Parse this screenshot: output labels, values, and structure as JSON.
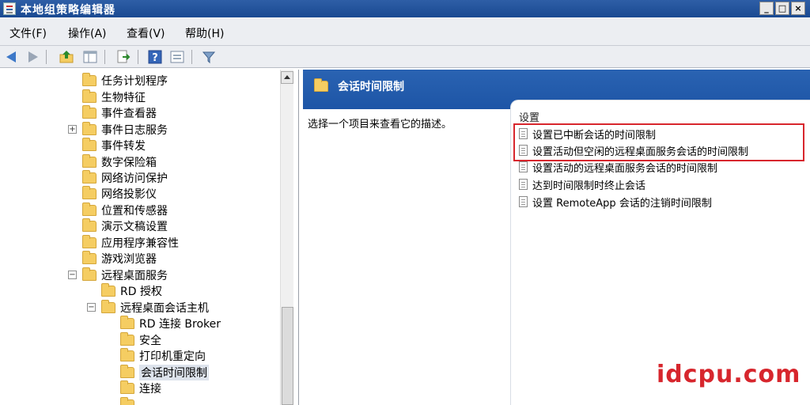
{
  "window": {
    "title": "本地组策略编辑器"
  },
  "window_controls": {
    "minimize": "_",
    "maximize": "□",
    "close": "×"
  },
  "menu": [
    "文件(F)",
    "操作(A)",
    "查看(V)",
    "帮助(H)"
  ],
  "toolbar": {
    "buttons": [
      "back-icon",
      "forward-icon",
      "up-folder-icon",
      "show-hide-tree-icon",
      "export-icon",
      "help-icon",
      "properties-icon",
      "filter-icon"
    ]
  },
  "tree": {
    "items": [
      {
        "label": "任务计划程序",
        "level": 0,
        "expander": ""
      },
      {
        "label": "生物特征",
        "level": 0,
        "expander": ""
      },
      {
        "label": "事件查看器",
        "level": 0,
        "expander": ""
      },
      {
        "label": "事件日志服务",
        "level": 0,
        "expander": "+"
      },
      {
        "label": "事件转发",
        "level": 0,
        "expander": ""
      },
      {
        "label": "数字保险箱",
        "level": 0,
        "expander": ""
      },
      {
        "label": "网络访问保护",
        "level": 0,
        "expander": ""
      },
      {
        "label": "网络投影仪",
        "level": 0,
        "expander": ""
      },
      {
        "label": "位置和传感器",
        "level": 0,
        "expander": ""
      },
      {
        "label": "演示文稿设置",
        "level": 0,
        "expander": ""
      },
      {
        "label": "应用程序兼容性",
        "level": 0,
        "expander": ""
      },
      {
        "label": "游戏浏览器",
        "level": 0,
        "expander": ""
      },
      {
        "label": "远程桌面服务",
        "level": 0,
        "expander": "−"
      },
      {
        "label": "RD 授权",
        "level": 1,
        "expander": ""
      },
      {
        "label": "远程桌面会话主机",
        "level": 1,
        "expander": "−"
      },
      {
        "label": "RD 连接 Broker",
        "level": 2,
        "expander": ""
      },
      {
        "label": "安全",
        "level": 2,
        "expander": ""
      },
      {
        "label": "打印机重定向",
        "level": 2,
        "expander": ""
      },
      {
        "label": "会话时间限制",
        "level": 2,
        "expander": "",
        "selected": true
      },
      {
        "label": "连接",
        "level": 2,
        "expander": ""
      }
    ]
  },
  "right": {
    "header_title": "会话时间限制",
    "description": "选择一个项目来查看它的描述。",
    "column_header": "设置",
    "settings": [
      "设置已中断会话的时间限制",
      "设置活动但空闲的远程桌面服务会话的时间限制",
      "设置活动的远程桌面服务会话的时间限制",
      "达到时间限制时终止会话",
      "设置 RemoteApp 会话的注销时间限制"
    ]
  },
  "colors": {
    "header_blue": "#1d55a6",
    "highlight_red": "#d8262d",
    "folder_yellow": "#f5cd62"
  },
  "watermark": "idcpu.com"
}
